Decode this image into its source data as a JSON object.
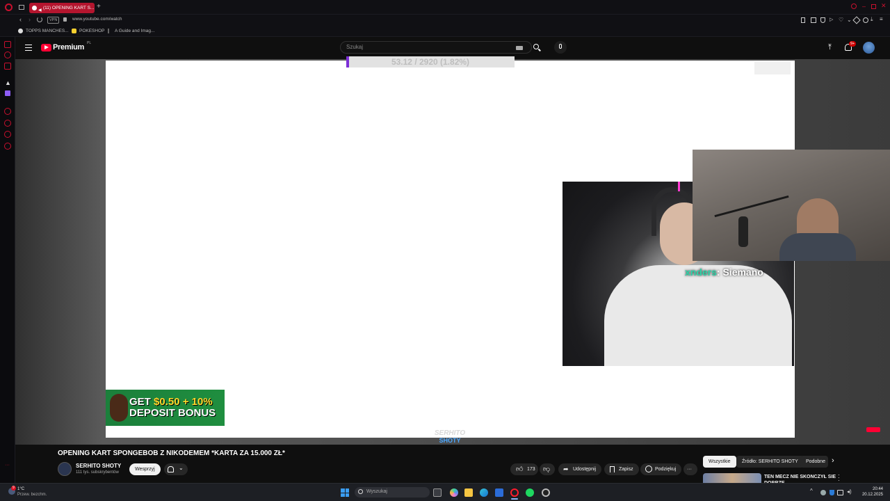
{
  "browser": {
    "tab_title": "(11) OPENING KART S...",
    "url": "www.youtube.com/watch",
    "vpn_label": "VPN",
    "bookmarks": [
      "TOPPS MANCHES...",
      "POKESHOP",
      "A Guide and Imag..."
    ]
  },
  "youtube": {
    "logo_text": "Premium",
    "logo_badge": "PL",
    "search_placeholder": "Szukaj",
    "notif_count": "9+"
  },
  "video": {
    "overlay_progress": "53.12 / 2920 (1.82%)",
    "overlay_progress_fraction": 0.0182,
    "chat_user": "xnders",
    "chat_message": ": Siemano",
    "ad_line1_a": "GET ",
    "ad_line1_b": "$0.50 + 10%",
    "ad_line2": "DEPOSIT BONUS",
    "watermark_line1": "SERHITO",
    "watermark_line2": "SHOTY"
  },
  "meta": {
    "title": "OPENING KART SPONGEBOB Z NIKODEMEM *KARTA ZA 15.000 ZŁ*",
    "channel_name": "SERHITO SHOTY",
    "subscribers": "111 tys. subskrybentów",
    "support_label": "Wesprzyj",
    "likes": "173",
    "share_label": "Udostępnij",
    "save_label": "Zapisz",
    "thanks_label": "Podziękuj"
  },
  "chips": [
    "Wszystkie",
    "Źródło: SERHITO SHOTY",
    "Podobne"
  ],
  "recommendation": {
    "title": "TEN MECZ NIE SKONCZYŁ SIE DOBRZE"
  },
  "taskbar": {
    "weather_temp": "1°C",
    "weather_desc": "Przew. bezchm.",
    "search_placeholder": "Wyszukaj",
    "time": "20:44",
    "date": "20.12.2025",
    "weather_badge": "9"
  }
}
